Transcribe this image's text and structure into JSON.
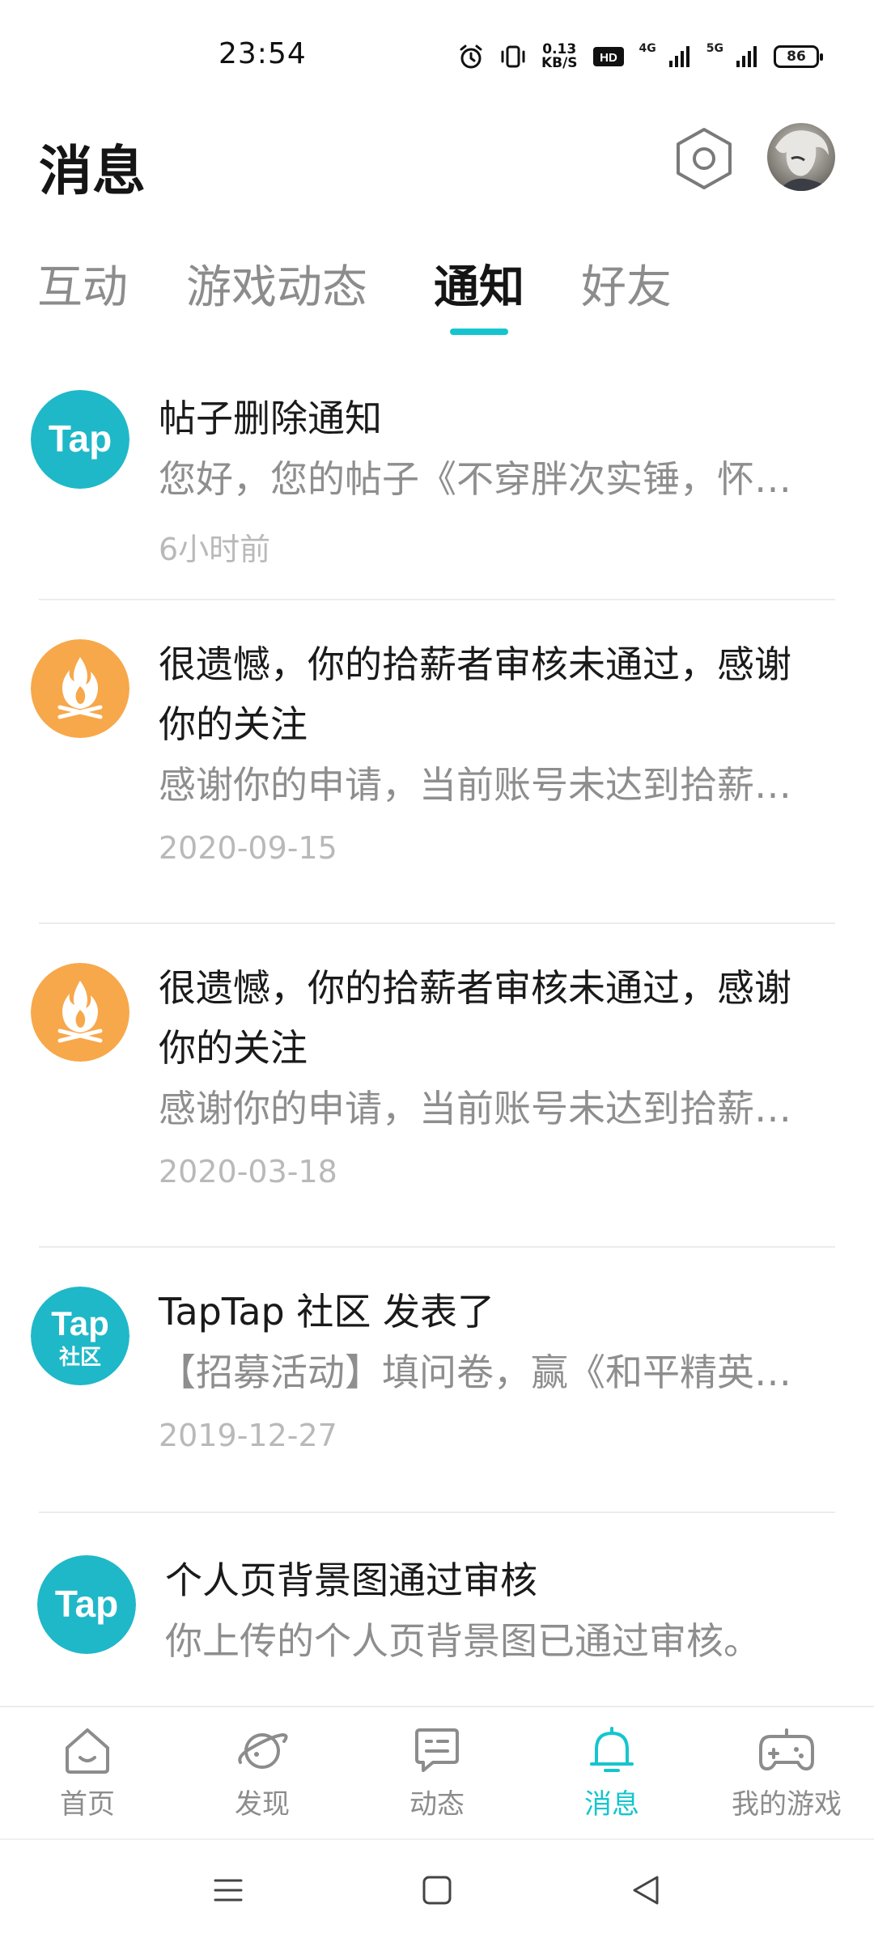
{
  "status_bar": {
    "time": "23:54",
    "net_speed_value": "0.13",
    "net_speed_unit": "KB/S",
    "hd_label": "HD",
    "signal1_label": "4G",
    "signal2_label": "5G",
    "battery": "86"
  },
  "header": {
    "title": "消息",
    "settings_icon": "hexagon-gear-icon",
    "avatar": "user-avatar"
  },
  "tabs": [
    {
      "label": "互动",
      "active": false
    },
    {
      "label": "游戏动态",
      "active": false
    },
    {
      "label": "通知",
      "active": true
    },
    {
      "label": "好友",
      "active": false
    }
  ],
  "notifications": [
    {
      "icon": "taptap-logo-icon",
      "title": "帖子删除通知",
      "body": "您好，您的帖子《不穿胖次实锤，怀疑是穿",
      "time": "6小时前"
    },
    {
      "icon": "campfire-icon",
      "title": "很遗憾，你的拾薪者审核未通过，感谢你的关注",
      "body": "感谢你的申请，当前账号未达到拾薪者申请门槛",
      "time": "2020-09-15"
    },
    {
      "icon": "campfire-icon",
      "title": "很遗憾，你的拾薪者审核未通过，感谢你的关注",
      "body": "感谢你的申请，当前账号未达到拾薪者申请门槛",
      "time": "2020-03-18"
    },
    {
      "icon": "taptap-community-icon",
      "title": "TapTap 社区 发表了",
      "body": "【招募活动】填问卷，赢《和平精英》周边好礼",
      "time": "2019-12-27"
    },
    {
      "icon": "taptap-logo-icon",
      "title": "个人页背景图通过审核",
      "body": "你上传的个人页背景图已通过审核。",
      "time": ""
    }
  ],
  "icon_text": {
    "tap": "Tap",
    "community": "社区"
  },
  "bottom_nav": [
    {
      "label": "首页",
      "icon": "home-icon",
      "active": false
    },
    {
      "label": "发现",
      "icon": "planet-icon",
      "active": false
    },
    {
      "label": "动态",
      "icon": "chat-icon",
      "active": false
    },
    {
      "label": "消息",
      "icon": "bell-icon",
      "active": true
    },
    {
      "label": "我的游戏",
      "icon": "gamepad-icon",
      "active": false
    }
  ],
  "colors": {
    "accent": "#15c5ce",
    "tap_blue": "#1fb8c8",
    "campfire_orange": "#f7a84a"
  }
}
